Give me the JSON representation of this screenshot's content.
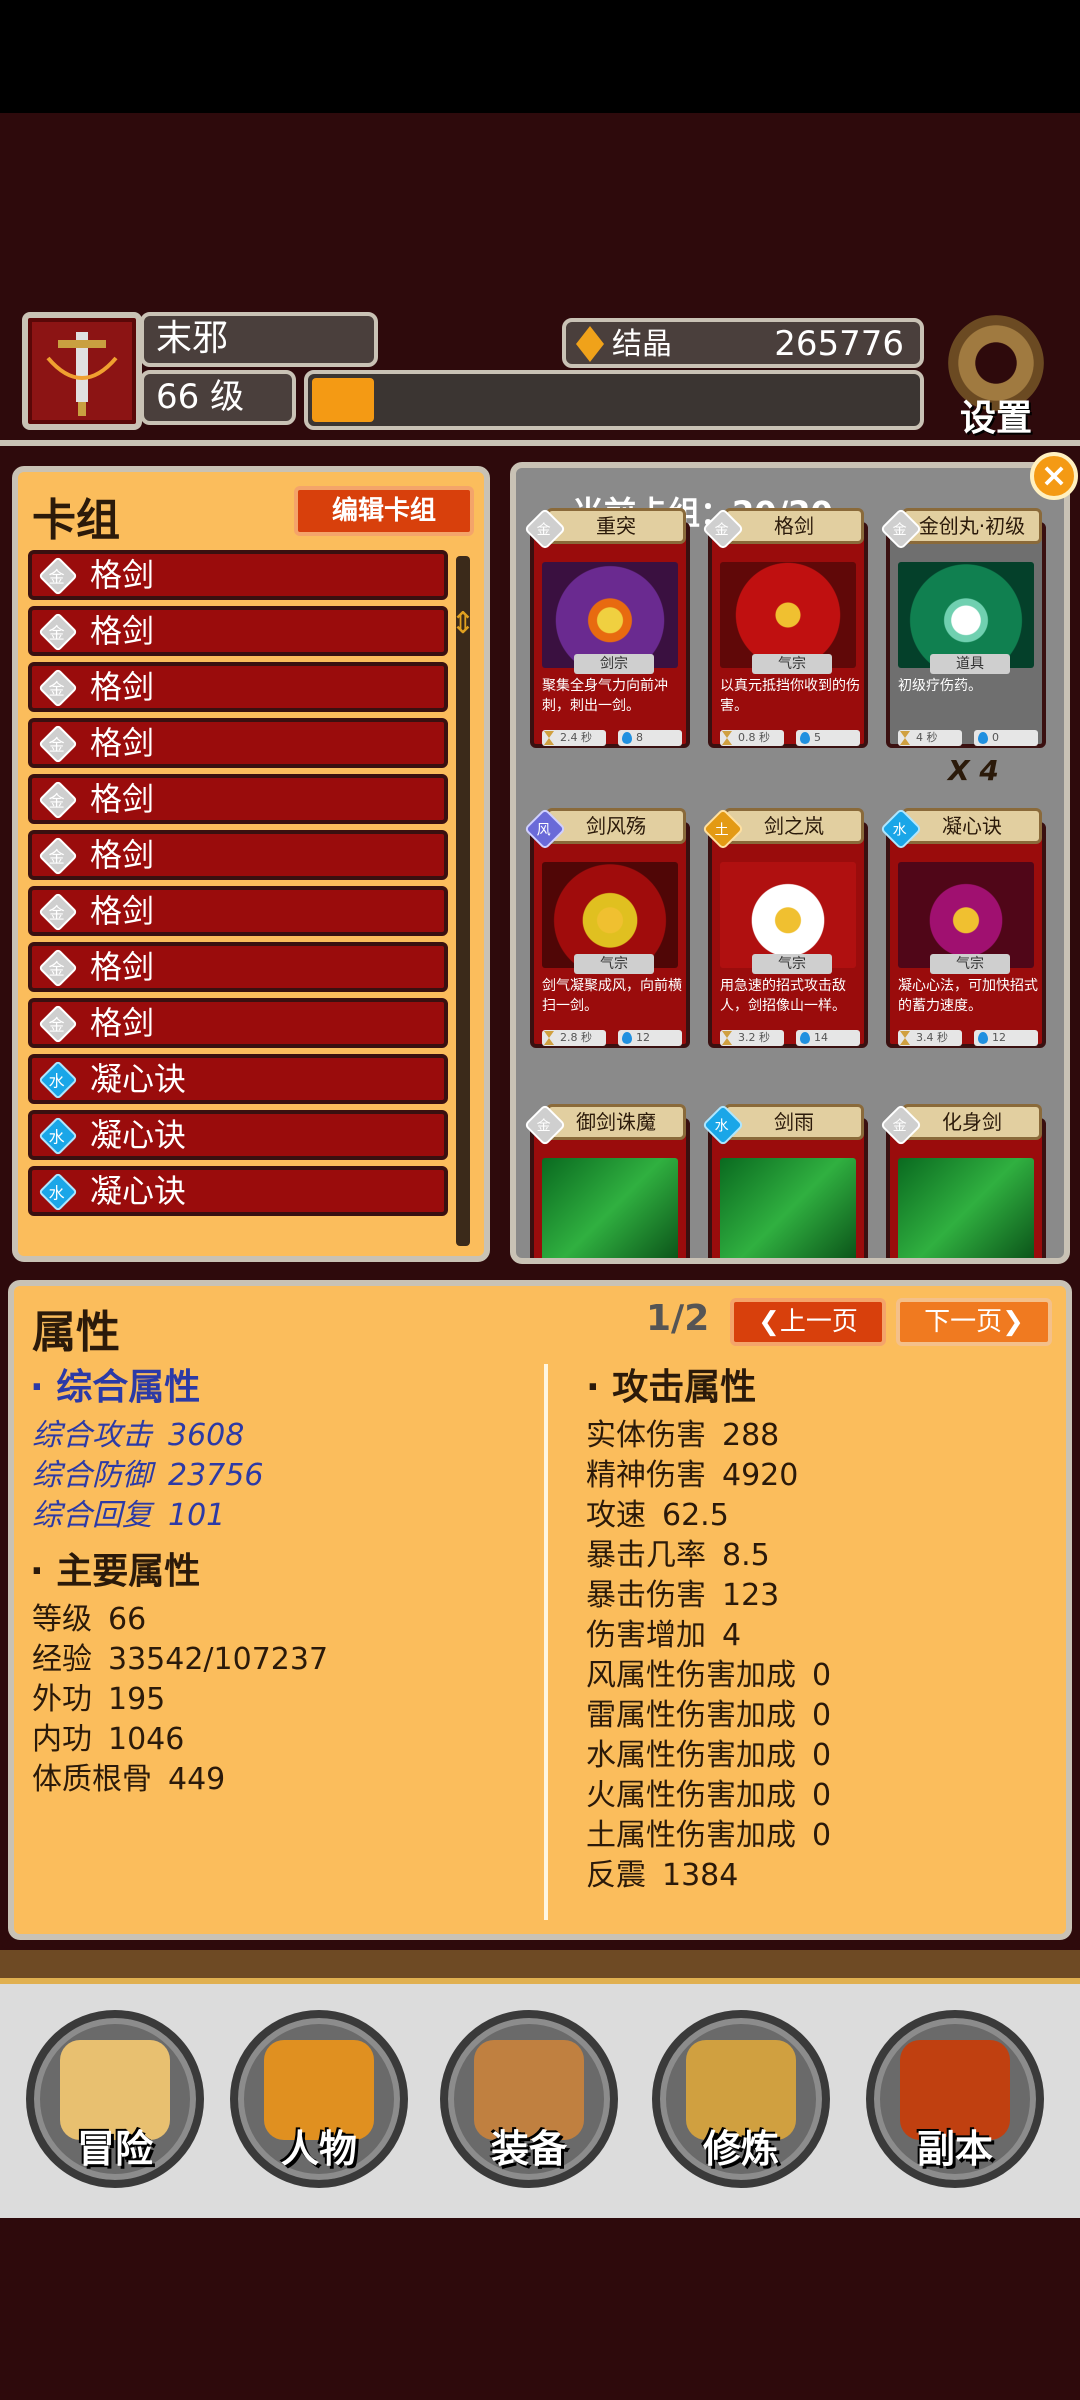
{
  "header": {
    "player_name": "末邪",
    "level_label": "66 级",
    "xp_progress": 0.102,
    "crystal_label": "结晶",
    "crystal_value": "265776",
    "settings_label": "设置"
  },
  "deck": {
    "title": "卡组",
    "edit_label": "编辑卡组",
    "items": [
      {
        "label": "格剑",
        "element": "metal",
        "glyph": "金"
      },
      {
        "label": "格剑",
        "element": "metal",
        "glyph": "金"
      },
      {
        "label": "格剑",
        "element": "metal",
        "glyph": "金"
      },
      {
        "label": "格剑",
        "element": "metal",
        "glyph": "金"
      },
      {
        "label": "格剑",
        "element": "metal",
        "glyph": "金"
      },
      {
        "label": "格剑",
        "element": "metal",
        "glyph": "金"
      },
      {
        "label": "格剑",
        "element": "metal",
        "glyph": "金"
      },
      {
        "label": "格剑",
        "element": "metal",
        "glyph": "金"
      },
      {
        "label": "格剑",
        "element": "metal",
        "glyph": "金"
      },
      {
        "label": "凝心诀",
        "element": "water",
        "glyph": "水"
      },
      {
        "label": "凝心诀",
        "element": "water",
        "glyph": "水"
      },
      {
        "label": "凝心诀",
        "element": "water",
        "glyph": "水"
      }
    ]
  },
  "current_deck": {
    "title": "当前卡组：20/20",
    "cards": [
      {
        "name": "重突",
        "element": "metal",
        "glyph": "金",
        "sect": "剑宗",
        "desc": "聚集全身气力向前冲刺，刺出一剑。",
        "cd": "2.4 秒",
        "cost": "8",
        "art": "art-red",
        "type": "skill"
      },
      {
        "name": "格剑",
        "element": "metal",
        "glyph": "金",
        "sect": "气宗",
        "desc": "以真元抵挡你收到的伤害。",
        "cd": "0.8 秒",
        "cost": "5",
        "art": "art-red2",
        "type": "skill"
      },
      {
        "name": "金创丸·初级",
        "element": "metal",
        "glyph": "金",
        "sect": "道具",
        "desc": "初级疗伤药。",
        "cd": "4 秒",
        "cost": "0",
        "art": "art-green",
        "type": "item",
        "count": "X 4"
      },
      {
        "name": "剑风殇",
        "element": "wind",
        "glyph": "风",
        "sect": "气宗",
        "desc": "剑气凝聚成风，向前横扫一剑。",
        "cd": "2.8 秒",
        "cost": "12",
        "art": "art-swirl",
        "type": "skill"
      },
      {
        "name": "剑之岚",
        "element": "earth",
        "glyph": "土",
        "sect": "气宗",
        "desc": "用急速的招式攻击敌人，剑招像山一样。",
        "cd": "3.2 秒",
        "cost": "14",
        "art": "art-white",
        "type": "skill"
      },
      {
        "name": "凝心诀",
        "element": "water",
        "glyph": "水",
        "sect": "气宗",
        "desc": "凝心心法，可加快招式的蓄力速度。",
        "cd": "3.4 秒",
        "cost": "12",
        "art": "art-dark",
        "type": "skill"
      },
      {
        "name": "御剑诛魔",
        "element": "metal",
        "glyph": "金",
        "art": "art-greenb",
        "type": "skill"
      },
      {
        "name": "剑雨",
        "element": "water",
        "glyph": "水",
        "art": "art-greenb",
        "type": "skill"
      },
      {
        "name": "化身剑",
        "element": "metal",
        "glyph": "金",
        "art": "art-greenb",
        "type": "skill"
      }
    ]
  },
  "attributes": {
    "title": "属性",
    "page": "1/2",
    "prev_label": "上一页",
    "next_label": "下一页",
    "composite_title": "· 综合属性",
    "composite": [
      {
        "label": "综合攻击",
        "value": "3608"
      },
      {
        "label": "综合防御",
        "value": "23756"
      },
      {
        "label": "综合回复",
        "value": "101"
      }
    ],
    "main_title": "· 主要属性",
    "main": [
      {
        "label": "等级",
        "value": "66"
      },
      {
        "label": "经验",
        "value": "33542/107237"
      },
      {
        "label": "外功",
        "value": "195"
      },
      {
        "label": "内功",
        "value": "1046"
      },
      {
        "label": "体质根骨",
        "value": "449"
      }
    ],
    "attack_title": "· 攻击属性",
    "attack": [
      {
        "label": "实体伤害",
        "value": "288"
      },
      {
        "label": "精神伤害",
        "value": "4920"
      },
      {
        "label": "攻速",
        "value": "62.5"
      },
      {
        "label": "暴击几率",
        "value": "8.5"
      },
      {
        "label": "暴击伤害",
        "value": "123"
      },
      {
        "label": "伤害增加",
        "value": "4"
      },
      {
        "label": "风属性伤害加成",
        "value": "0"
      },
      {
        "label": "雷属性伤害加成",
        "value": "0"
      },
      {
        "label": "水属性伤害加成",
        "value": "0"
      },
      {
        "label": "火属性伤害加成",
        "value": "0"
      },
      {
        "label": "土属性伤害加成",
        "value": "0"
      },
      {
        "label": "反震",
        "value": "1384"
      }
    ]
  },
  "nav": [
    {
      "label": "冒险",
      "icon": "map-icon",
      "color": "#e8c070"
    },
    {
      "label": "人物",
      "icon": "helmet-icon",
      "color": "#e09020"
    },
    {
      "label": "装备",
      "icon": "treasure-chest-icon",
      "color": "#c08040"
    },
    {
      "label": "修炼",
      "icon": "yin-yang-icon",
      "color": "#d0a040"
    },
    {
      "label": "副本",
      "icon": "portal-icon",
      "color": "#c04010"
    }
  ]
}
